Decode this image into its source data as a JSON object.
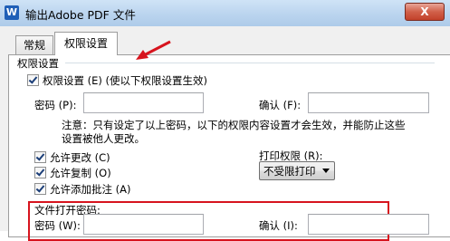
{
  "window": {
    "title": "输出Adobe PDF 文件",
    "app_icon_letter": "W",
    "close_symbol": "X"
  },
  "tabs": [
    {
      "label": "常规",
      "active": false
    },
    {
      "label": "权限设置",
      "active": true
    }
  ],
  "permissions": {
    "group_title": "权限设置",
    "enable_label": "权限设置 (E) (使以下权限设置生效)",
    "enable_checked": true,
    "password_label": "密码 (P):",
    "password_value": "",
    "confirm_label": "确认 (F):",
    "confirm_value": "",
    "note_line1": "注意：只有设定了以上密码，以下的权限内容设置才会生效，并能防止这些",
    "note_line2": "设置被他人更改。",
    "allow_change_label": "允许更改 (C)",
    "allow_change_checked": true,
    "allow_copy_label": "允许复制 (O)",
    "allow_copy_checked": true,
    "allow_annotate_label": "允许添加批注 (A)",
    "allow_annotate_checked": true,
    "print_label": "打印权限 (R):",
    "print_value": "不受限打印"
  },
  "open_password": {
    "title": "文件打开密码:",
    "password_label": "密码 (W):",
    "password_value": "",
    "confirm_label": "确认 (I):",
    "confirm_value": ""
  },
  "colors": {
    "annotation_red": "#d7141e",
    "titlebar_blue": "#b9d3ee",
    "close_red": "#c2412a"
  }
}
